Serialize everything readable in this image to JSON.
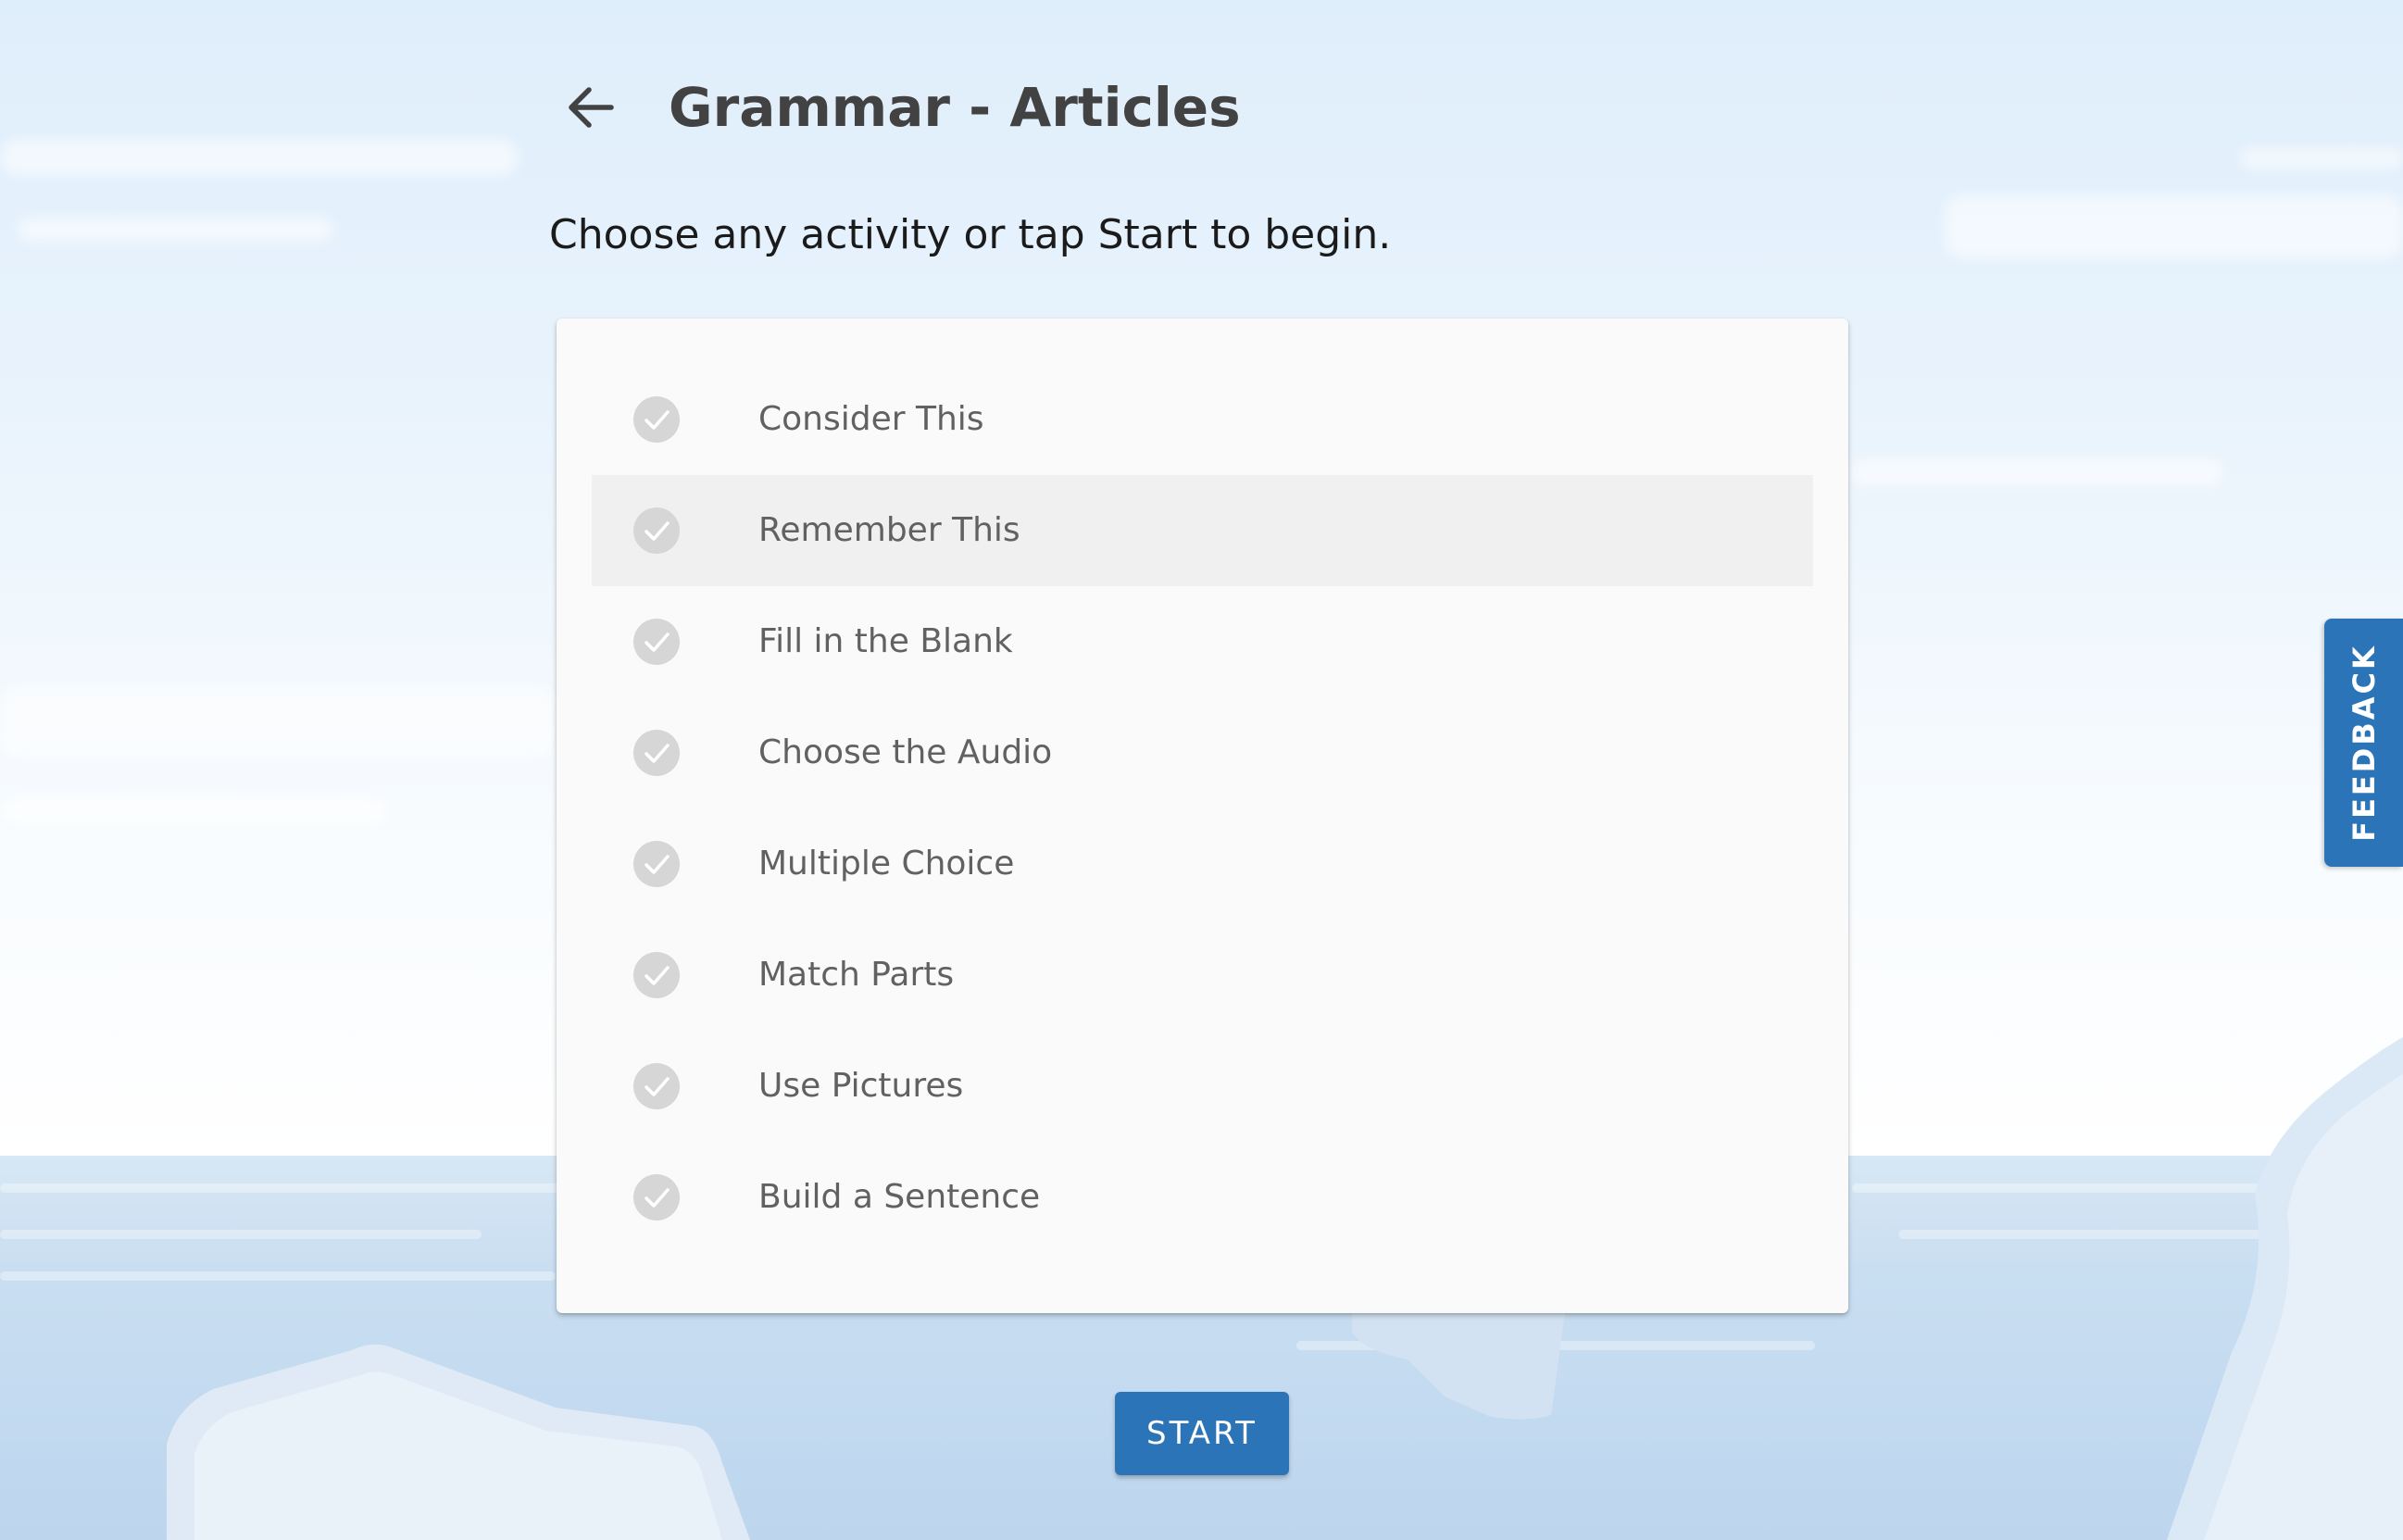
{
  "header": {
    "back_icon": "arrow-left-icon",
    "title": "Grammar - Articles"
  },
  "instructions": "Choose any activity or tap Start to begin.",
  "activities": [
    {
      "label": "Consider This",
      "icon": "check-circle-icon",
      "highlighted": false
    },
    {
      "label": "Remember This",
      "icon": "check-circle-icon",
      "highlighted": true
    },
    {
      "label": "Fill in the Blank",
      "icon": "check-circle-icon",
      "highlighted": false
    },
    {
      "label": "Choose the Audio",
      "icon": "check-circle-icon",
      "highlighted": false
    },
    {
      "label": "Multiple Choice",
      "icon": "check-circle-icon",
      "highlighted": false
    },
    {
      "label": "Match Parts",
      "icon": "check-circle-icon",
      "highlighted": false
    },
    {
      "label": "Use Pictures",
      "icon": "check-circle-icon",
      "highlighted": false
    },
    {
      "label": "Build a Sentence",
      "icon": "check-circle-icon",
      "highlighted": false
    }
  ],
  "start_button": {
    "label": "START"
  },
  "feedback_tab": {
    "label": "FEEDBACK"
  },
  "colors": {
    "accent": "#2b74b8",
    "title_text": "#424242",
    "item_text": "#616161",
    "check_circle": "#d6d6d6",
    "highlight_row": "#f0f0f0",
    "card_background": "#fafafa"
  }
}
